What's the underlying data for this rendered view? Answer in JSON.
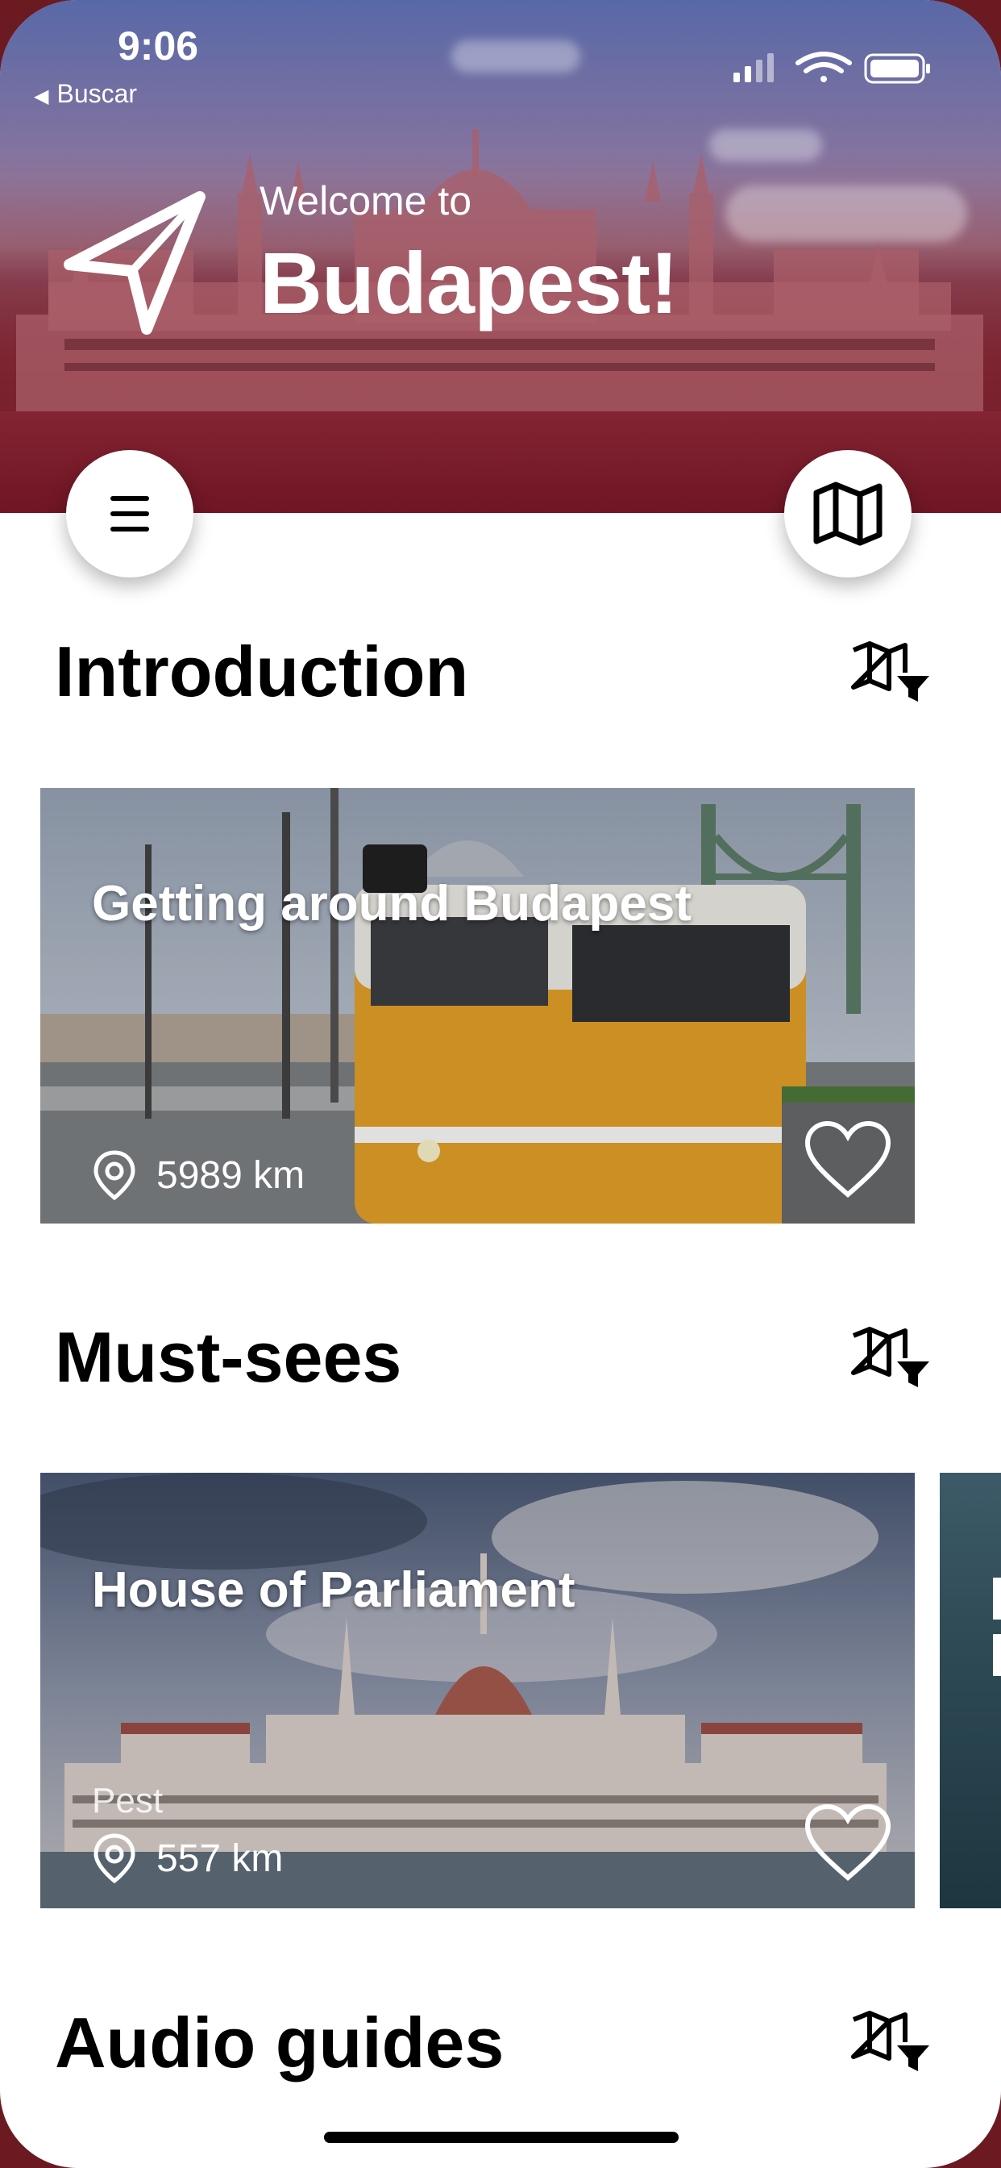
{
  "status_bar": {
    "time": "9:06",
    "back_label": "Buscar",
    "icons": [
      "signal-icon",
      "wifi-icon",
      "battery-icon"
    ]
  },
  "header": {
    "welcome": "Welcome to",
    "city": "Budapest!",
    "icon": "navigation-arrow-icon"
  },
  "buttons": {
    "menu_icon": "hamburger-menu-icon",
    "map_icon": "map-icon"
  },
  "sections": [
    {
      "title": "Introduction",
      "filter_icon": "map-filter-icon",
      "cards": [
        {
          "title": "Getting around Budapest",
          "subtitle": "",
          "distance": "5989 km",
          "favorite_icon": "heart-icon"
        }
      ]
    },
    {
      "title": "Must-sees",
      "filter_icon": "map-filter-icon",
      "cards": [
        {
          "title": "House of Parliament",
          "subtitle": "Pest",
          "distance": "557 km",
          "favorite_icon": "heart-icon"
        }
      ]
    },
    {
      "title": "Audio guides",
      "filter_icon": "map-filter-icon",
      "cards": []
    }
  ],
  "colors": {
    "header_tint": "#7a1e2c",
    "tram_yellow": "#e8a32a",
    "text_primary": "#000000",
    "on_image_text": "#ffffff"
  }
}
